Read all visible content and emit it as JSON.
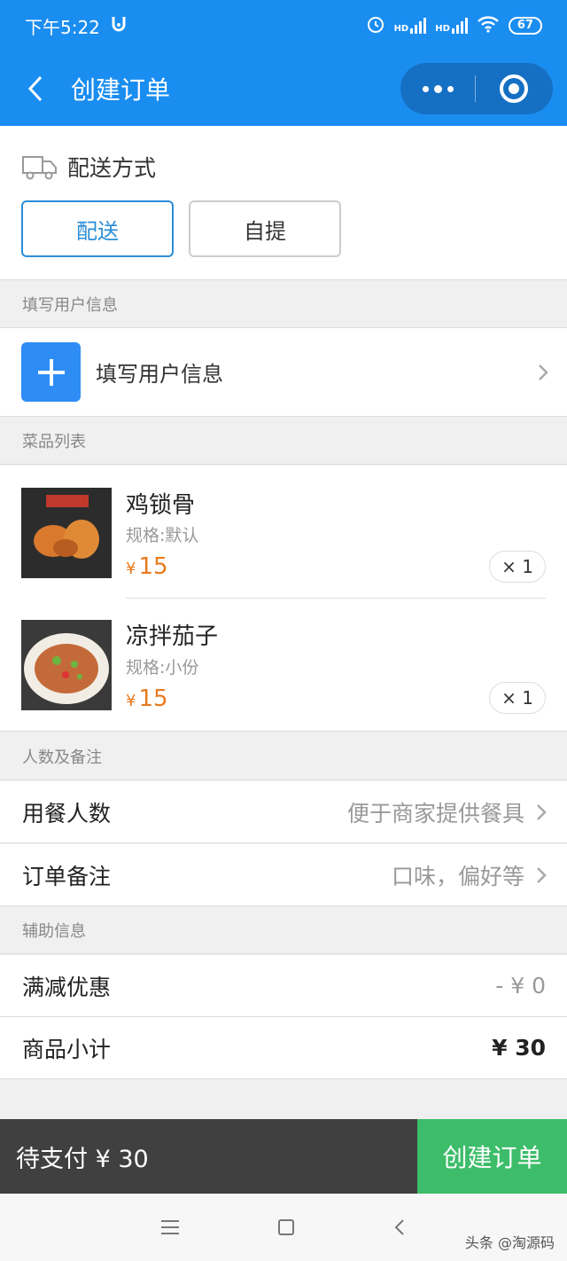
{
  "status_bar": {
    "time": "下午5:22",
    "network_labels": [
      "HD",
      "HD"
    ],
    "battery": "67"
  },
  "nav": {
    "title": "创建订单"
  },
  "delivery": {
    "title": "配送方式",
    "options": [
      {
        "label": "配送",
        "selected": true
      },
      {
        "label": "自提",
        "selected": false
      }
    ]
  },
  "user_info": {
    "section": "填写用户信息",
    "action_label": "填写用户信息"
  },
  "dishes": {
    "section": "菜品列表",
    "items": [
      {
        "name": "鸡锁骨",
        "spec": "规格:默认",
        "currency": "¥",
        "price": "15",
        "qty": "× 1"
      },
      {
        "name": "凉拌茄子",
        "spec": "规格:小份",
        "currency": "¥",
        "price": "15",
        "qty": "× 1"
      }
    ]
  },
  "people": {
    "section": "人数及备注",
    "rows": [
      {
        "label": "用餐人数",
        "placeholder": "便于商家提供餐具"
      },
      {
        "label": "订单备注",
        "placeholder": "口味，偏好等"
      }
    ]
  },
  "aux": {
    "section": "辅助信息",
    "rows": [
      {
        "label": "满减优惠",
        "value": "- ¥ 0"
      },
      {
        "label": "商品小计",
        "value": "¥ 30"
      }
    ]
  },
  "footer": {
    "pending": "待支付 ¥ 30",
    "submit": "创建订单"
  },
  "watermark": "头条 @淘源码",
  "colors": {
    "primary": "#1a8df0",
    "accent": "#2b8dd6",
    "price": "#e87a1e",
    "submit": "#3dbd6a"
  }
}
